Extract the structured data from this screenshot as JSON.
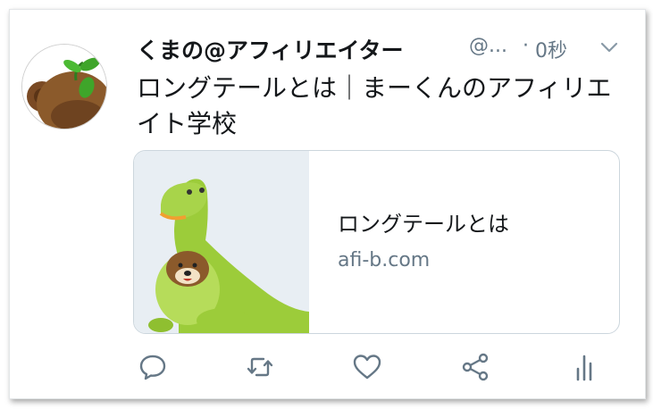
{
  "tweet": {
    "display_name": "くまの@アフィリエイター",
    "handle": "@...",
    "separator": "·",
    "time": "0秒",
    "text": "ロングテールとは｜まーくんのアフィリエイト学校"
  },
  "card": {
    "title": "ロングテールとは",
    "domain": "afi-b.com"
  },
  "icons": [
    "caret-down-icon",
    "reply-icon",
    "retweet-icon",
    "like-icon",
    "share-icon",
    "analytics-icon"
  ],
  "colors": {
    "text_primary": "#14171a",
    "text_secondary": "#657786",
    "icon_gray": "#657786",
    "border": "#ccd6dd"
  }
}
